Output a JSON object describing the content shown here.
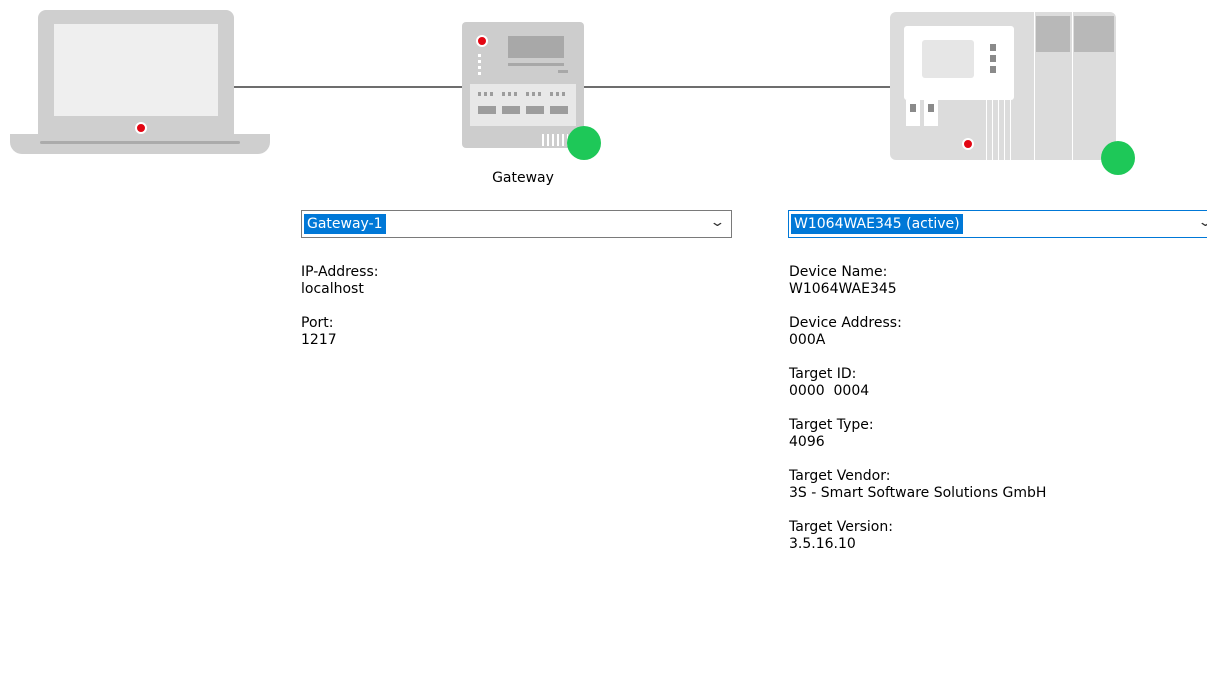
{
  "gateway": {
    "caption": "Gateway",
    "select_value": "Gateway-1",
    "status_color": "#1ec858",
    "fields": [
      {
        "label": "IP-Address:",
        "value": "localhost"
      },
      {
        "label": "Port:",
        "value": "1217"
      }
    ]
  },
  "device": {
    "select_value": "W1064WAE345 (active)",
    "status_color": "#1ec858",
    "fields": [
      {
        "label": "Device Name:",
        "value": "W1064WAE345"
      },
      {
        "label": "Device Address:",
        "value": "000A"
      },
      {
        "label": "Target ID:",
        "value": "0000  0004"
      },
      {
        "label": "Target Type:",
        "value": "4096"
      },
      {
        "label": "Target Vendor:",
        "value": "3S - Smart Software Solutions GmbH"
      },
      {
        "label": "Target Version:",
        "value": "3.5.16.10"
      }
    ]
  },
  "icons": {
    "computer": "laptop-icon",
    "gateway": "gateway-device-icon",
    "controller": "plc-device-icon",
    "dropdown": "chevron-down-icon"
  },
  "colors": {
    "accent": "#0078d7",
    "status_ok": "#1ec858",
    "indicator_red": "#e30613",
    "device_gray": "#cdcdcd"
  }
}
